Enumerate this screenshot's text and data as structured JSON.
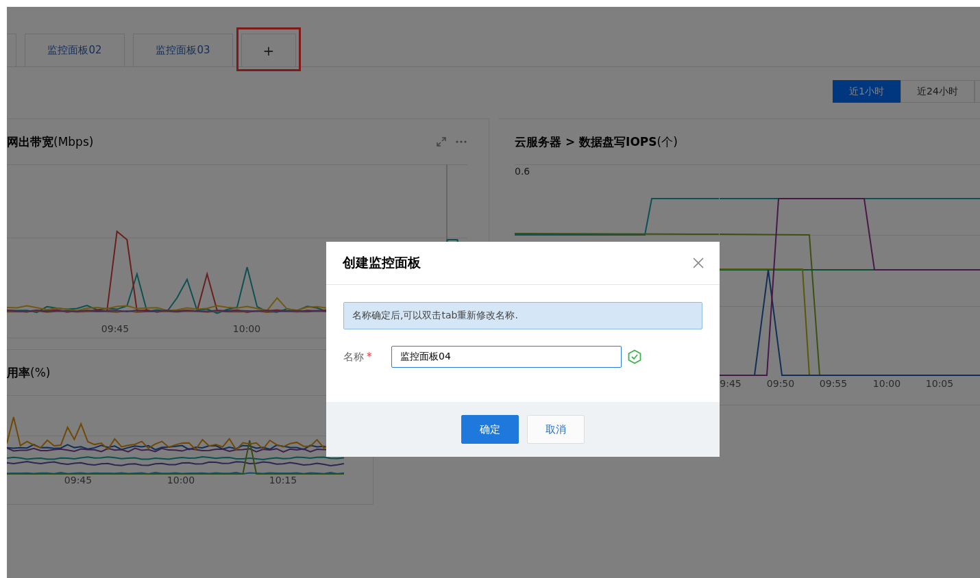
{
  "tabs": [
    {
      "label": "监控面板02",
      "kind": "tab",
      "highlighted": false
    },
    {
      "label": "监控面板03",
      "kind": "tab",
      "highlighted": false
    },
    {
      "label": "+",
      "kind": "add",
      "highlighted": true
    }
  ],
  "time_range": [
    {
      "label": "近1小时",
      "selected": true
    },
    {
      "label": "近24小时",
      "selected": false
    }
  ],
  "panels": [
    {
      "kind": "bandwidth",
      "title": "**网出带宽**(Mbps)",
      "x_labels": [
        "09:45",
        "10:00"
      ]
    },
    {
      "kind": "usage",
      "title": "**用率**(%)",
      "x_labels": [
        "09:45",
        "10:00",
        "10:15"
      ]
    },
    {
      "kind": "iops",
      "title": "**云服务器 > 数据盘写IOPS**(个)",
      "y_labels": [
        "0.6"
      ],
      "x_labels": [
        "9:45",
        "09:50",
        "09:55",
        "10:00",
        "10:05"
      ]
    }
  ],
  "dialog": {
    "title": "创建监控面板",
    "notice": "名称确定后,可以双击tab重新修改名称.",
    "field": {
      "label": "名称",
      "required": true,
      "required_mark": "*",
      "value": "监控面板04",
      "valid": true
    },
    "buttons": [
      {
        "label": "确定",
        "kind": "primary"
      },
      {
        "label": "取消",
        "kind": "default"
      }
    ]
  }
}
